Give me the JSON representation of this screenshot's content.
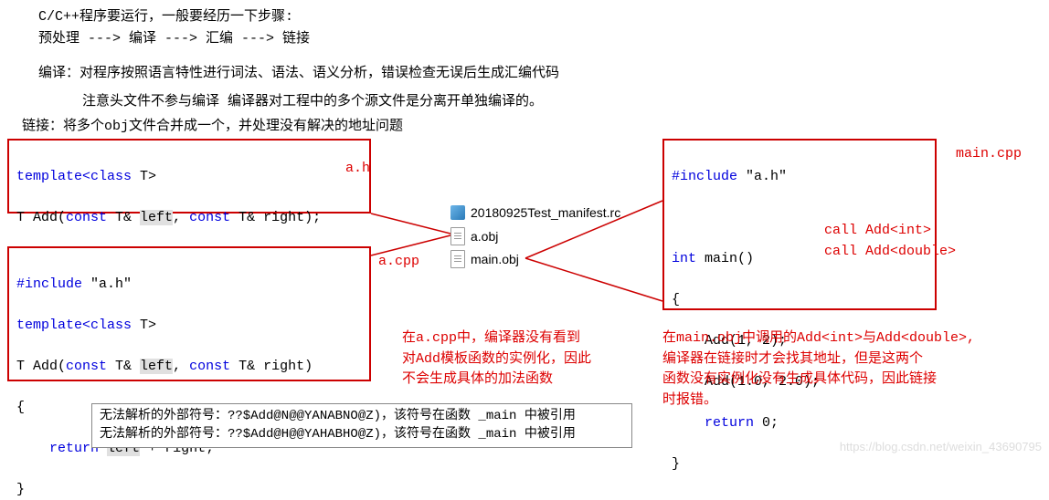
{
  "intro": {
    "line1": "C/C++程序要运行，一般要经历一下步骤:",
    "line2": "预处理 ---> 编译 ---> 汇编 ---> 链接",
    "compile": "编译：对程序按照语言特性进行词法、语法、语义分析，错误检查无误后生成汇编代码",
    "note": "注意头文件不参与编译  编译器对工程中的多个源文件是分离开单独编译的。",
    "link": "链接：将多个obj文件合并成一个，并处理没有解决的地址问题"
  },
  "ah": {
    "label": "a.h",
    "l1a": "template<",
    "l1b": "class",
    "l1c": " T>",
    "l2a": "T Add(",
    "l2b": "const",
    "l2c": " T& ",
    "l2d": "left",
    "l2e": ", ",
    "l2f": "const",
    "l2g": " T& right);"
  },
  "acpp": {
    "label": "a.cpp",
    "l1a": "#include ",
    "l1b": "\"a.h\"",
    "l2a": "template<",
    "l2b": "class",
    "l2c": " T>",
    "l3a": "T Add(",
    "l3b": "const",
    "l3c": " T& ",
    "l3d": "left",
    "l3e": ", ",
    "l3f": "const",
    "l3g": " T& right)",
    "l4": "{",
    "l5a": "    ",
    "l5b": "return",
    "l5c": " ",
    "l5d": "left",
    "l5e": " + right;",
    "l6": "}"
  },
  "maincpp": {
    "label": "main.cpp",
    "l1a": "#include ",
    "l1b": "\"a.h\"",
    "l2a": "int",
    "l2b": " main()",
    "l3": "{",
    "l4": "    Add(1, 2);",
    "l5": "    Add(1.0, 2.0);",
    "l6a": "    ",
    "l6b": "return",
    "l6c": " 0;",
    "l7": "}",
    "c1": "call Add<int>",
    "c2": "call Add<double>"
  },
  "files": {
    "rc": "20180925Test_manifest.rc",
    "aobj": "a.obj",
    "mainobj": "main.obj"
  },
  "note_a": {
    "l1": "在a.cpp中，编译器没有看到",
    "l2": "对Add模板函数的实例化，因此",
    "l3": "不会生成具体的加法函数"
  },
  "note_main": {
    "l1": "在main.obj中调用的Add<int>与Add<double>,",
    "l2": "编译器在链接时才会找其地址，但是这两个",
    "l3": "函数没有实例化没有生成具体代码，因此链接",
    "l4": "时报错。"
  },
  "errors": {
    "l1": "无法解析的外部符号：??$Add@N@@YANABNO@Z)，该符号在函数 _main 中被引用",
    "l2": "无法解析的外部符号：??$Add@H@@YAHABHO@Z)，该符号在函数 _main 中被引用"
  },
  "watermark": "https://blog.csdn.net/weixin_43690795"
}
